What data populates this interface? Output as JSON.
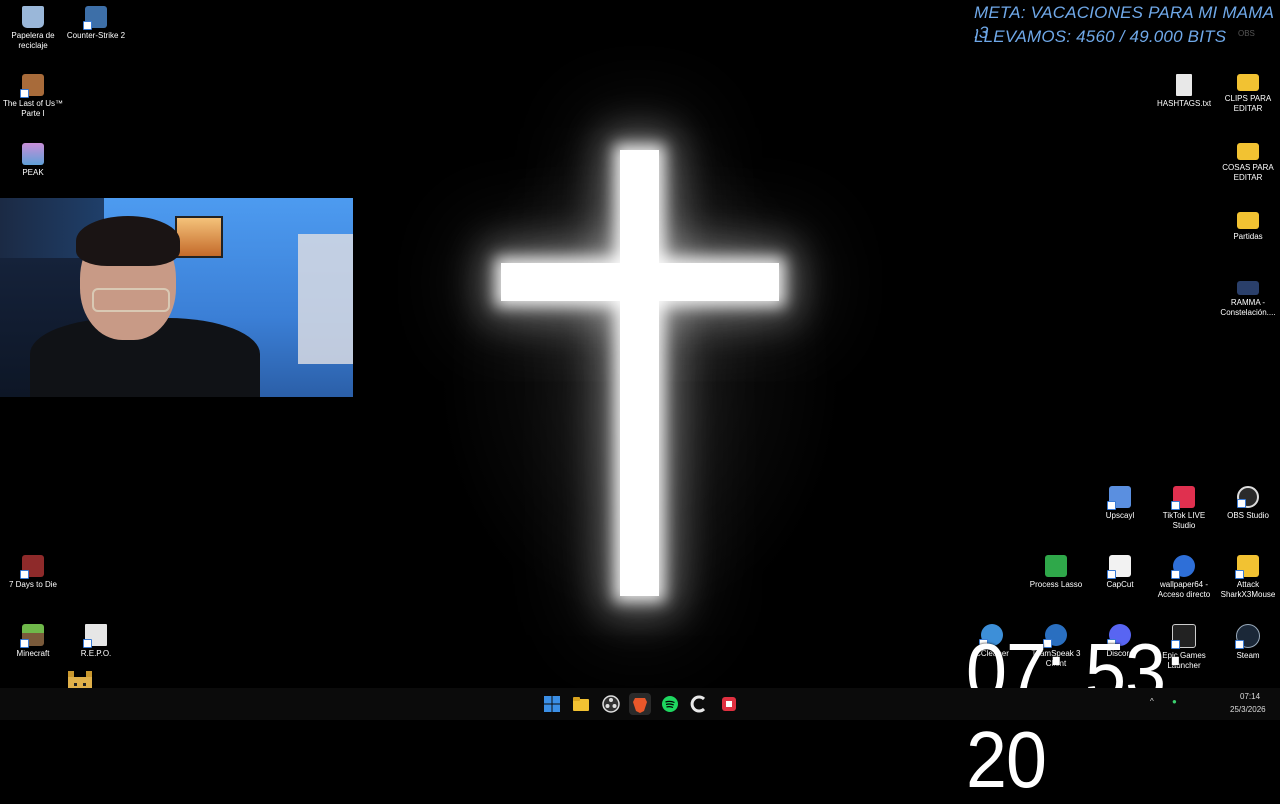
{
  "overlay": {
    "goal_text": "META: VACACIONES PARA MI MAMA :3",
    "progress_text": "LLEVAMOS: 4560 / 49.000 BITS"
  },
  "clock": {
    "big_time": "07: 53: 20",
    "tray_time": "07:14",
    "tray_date": "25/3/2026"
  },
  "desktop_icons": {
    "left": [
      {
        "label": "Papelera de reciclaje",
        "icon": "recycle-bin-icon",
        "color": "#9ab7d9"
      },
      {
        "label": "Counter-Strike 2",
        "icon": "counter-strike-icon",
        "color": "#3d6fa8"
      },
      {
        "label": "The Last of Us™ Parte I",
        "icon": "last-of-us-icon",
        "color": "#a86b3a"
      },
      {
        "label": "PEAK",
        "icon": "peak-icon",
        "color": "#c98fd8"
      },
      {
        "label": "7 Days to Die",
        "icon": "seven-days-icon",
        "color": "#8e2a2a"
      },
      {
        "label": "Minecraft",
        "icon": "minecraft-icon",
        "color": "#4f8a3a"
      },
      {
        "label": "R.E.P.O.",
        "icon": "repo-icon",
        "color": "#e6e6e6"
      }
    ],
    "right": [
      {
        "label": "HASHTAGS.txt",
        "icon": "text-file-icon",
        "color": "#e8e8e8"
      },
      {
        "label": "CLIPS PARA EDITAR",
        "icon": "folder-icon",
        "color": "#f2c232"
      },
      {
        "label": "COSAS PARA EDITAR",
        "icon": "folder-icon",
        "color": "#f2c232"
      },
      {
        "label": "Partidas",
        "icon": "folder-icon",
        "color": "#f2c232"
      },
      {
        "label": "RAMMA - Constelación....",
        "icon": "video-file-icon",
        "color": "#2a3f6a"
      },
      {
        "label": "Upscayl",
        "icon": "upscayl-icon",
        "color": "#5a8fe0"
      },
      {
        "label": "TikTok LIVE Studio",
        "icon": "tiktok-live-icon",
        "color": "#e0304f"
      },
      {
        "label": "OBS Studio",
        "icon": "obs-icon",
        "color": "#2b2b2b"
      },
      {
        "label": "Process Lasso",
        "icon": "process-lasso-icon",
        "color": "#2fa84a"
      },
      {
        "label": "CapCut",
        "icon": "capcut-icon",
        "color": "#f2f2f2"
      },
      {
        "label": "wallpaper64 - Acceso directo",
        "icon": "wallpaper-engine-icon",
        "color": "#2e6fd8"
      },
      {
        "label": "Attack SharkX3Mouse",
        "icon": "attack-shark-icon",
        "color": "#f2c232"
      },
      {
        "label": "CCleaner",
        "icon": "ccleaner-icon",
        "color": "#3d8fd8"
      },
      {
        "label": "TeamSpeak 3 Client",
        "icon": "teamspeak-icon",
        "color": "#2a6fc0"
      },
      {
        "label": "Discord",
        "icon": "discord-icon",
        "color": "#5865f2"
      },
      {
        "label": "Epic Games Launcher",
        "icon": "epic-games-icon",
        "color": "#222222"
      },
      {
        "label": "Steam",
        "icon": "steam-icon",
        "color": "#1b2838"
      }
    ],
    "obs_top_label": "OBS"
  },
  "taskbar": {
    "apps": [
      {
        "name": "start-button",
        "icon": "windows-icon",
        "color": "#3b8fe6"
      },
      {
        "name": "file-explorer",
        "icon": "folder-icon",
        "color": "#f2c232"
      },
      {
        "name": "obs-studio",
        "icon": "obs-icon",
        "color": "#e0e0e0"
      },
      {
        "name": "brave-browser",
        "icon": "brave-icon",
        "color": "#e8572a"
      },
      {
        "name": "spotify",
        "icon": "spotify-icon",
        "color": "#1ed760"
      },
      {
        "name": "ccleaner",
        "icon": "ccleaner-icon",
        "color": "#e8e8e8"
      },
      {
        "name": "streamlabs",
        "icon": "streamlabs-icon",
        "color": "#e03040"
      }
    ]
  }
}
